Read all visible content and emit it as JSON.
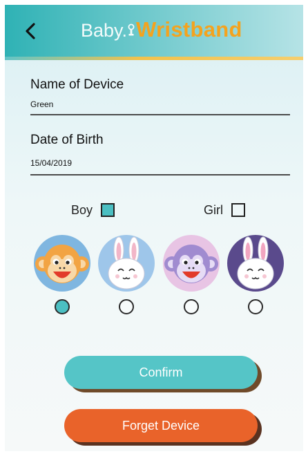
{
  "header": {
    "brand_prefix": "Baby.",
    "brand_suffix": "Wristband",
    "back_icon": "chevron-left-icon"
  },
  "form": {
    "device_name_label": "Name of Device",
    "device_name_value": "Green",
    "birth_date_label": "Date of Birth",
    "birth_date_value": "15/04/2019"
  },
  "gender": {
    "boy_label": "Boy",
    "girl_label": "Girl",
    "boy_checked": true,
    "girl_checked": false
  },
  "avatars": [
    {
      "icon": "monkey-icon",
      "selected": true
    },
    {
      "icon": "bunny-icon",
      "selected": false
    },
    {
      "icon": "monkey-icon",
      "selected": false
    },
    {
      "icon": "bunny-icon",
      "selected": false
    }
  ],
  "buttons": {
    "confirm_label": "Confirm",
    "forget_label": "Forget Device"
  },
  "colors": {
    "teal": "#4bbfc2",
    "orange": "#e9632a",
    "brand_orange": "#f4a31e"
  }
}
